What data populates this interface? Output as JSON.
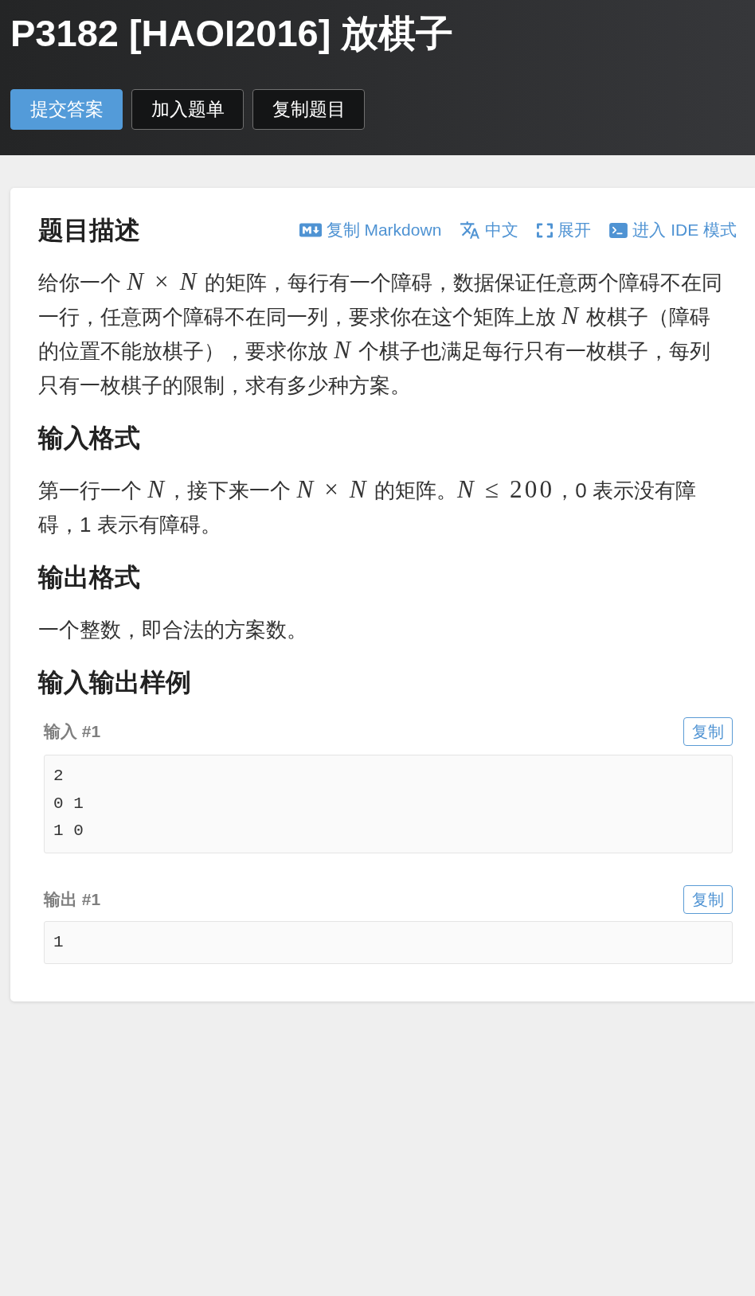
{
  "header": {
    "title": "P3182 [HAOI2016] 放棋子",
    "buttons": [
      {
        "label": "提交答案",
        "kind": "primary"
      },
      {
        "label": "加入题单",
        "kind": "dark"
      },
      {
        "label": "复制题目",
        "kind": "dark"
      }
    ]
  },
  "problem": {
    "toolbar": [
      {
        "kind": "markdown",
        "label": "复制 Markdown"
      },
      {
        "kind": "translate",
        "label": "中文"
      },
      {
        "kind": "expand",
        "label": "展开"
      },
      {
        "kind": "terminal",
        "label": "进入 IDE 模式"
      }
    ],
    "sections": [
      {
        "title": "题目描述",
        "paragraph": [
          {
            "kind": "text",
            "text": "给你一个 "
          },
          {
            "kind": "math",
            "text": "*N* × *N*"
          },
          {
            "kind": "text",
            "text": " 的矩阵，每行有一个障碍，数据保证任意两个障碍不在同一行，任意两个障碍不在同一列，要求你在这个矩阵上放 "
          },
          {
            "kind": "math",
            "text": "*N*"
          },
          {
            "kind": "text",
            "text": " 枚棋子（障碍的位置不能放棋子），要求你放 "
          },
          {
            "kind": "math",
            "text": "*N*"
          },
          {
            "kind": "text",
            "text": " 个棋子也满足每行只有一枚棋子，每列只有一枚棋子的限制，求有多少种方案。"
          }
        ]
      },
      {
        "title": "输入格式",
        "paragraph": [
          {
            "kind": "text",
            "text": "第一行一个 "
          },
          {
            "kind": "math",
            "text": "*N*"
          },
          {
            "kind": "text",
            "text": "，接下来一个 "
          },
          {
            "kind": "math",
            "text": "*N* × *N*"
          },
          {
            "kind": "text",
            "text": " 的矩阵。"
          },
          {
            "kind": "math",
            "text": "*N* ≤ 200"
          },
          {
            "kind": "text",
            "text": "，0 表示没有障碍，1 表示有障碍。"
          }
        ]
      },
      {
        "title": "输出格式",
        "paragraph": [
          {
            "kind": "text",
            "text": "一个整数，即合法的方案数。"
          }
        ]
      }
    ],
    "samples": {
      "title": "输入输出样例",
      "items": [
        {
          "label": "输入 #1",
          "copy_button": "复制",
          "content": "2\n0 1\n1 0"
        },
        {
          "label": "输出 #1",
          "copy_button": "复制",
          "content": "1"
        }
      ]
    }
  }
}
